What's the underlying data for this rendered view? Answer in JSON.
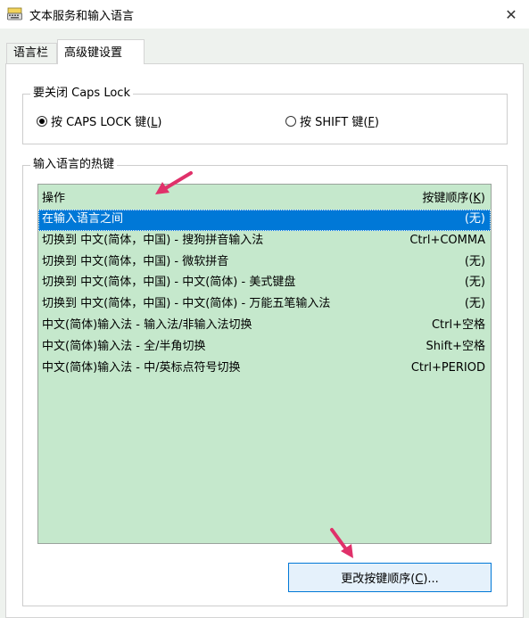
{
  "window": {
    "title": "文本服务和输入语言",
    "close_glyph": "✕",
    "icon": "keyboard-icon"
  },
  "tabs": [
    {
      "label": "语言栏",
      "selected": false
    },
    {
      "label": "高级键设置",
      "selected": true
    }
  ],
  "caps_lock_group": {
    "title": "要关闭 Caps Lock",
    "options": [
      {
        "label_prefix": "按 CAPS LOCK 键(",
        "accel": "L",
        "label_suffix": ")",
        "checked": true
      },
      {
        "label_prefix": "按 SHIFT 键(",
        "accel": "F",
        "label_suffix": ")",
        "checked": false
      }
    ]
  },
  "hotkeys_group": {
    "title": "输入语言的热键",
    "columns": {
      "action": "操作",
      "key_prefix": "按键顺序(",
      "key_accel": "K",
      "key_suffix": ")"
    },
    "rows": [
      {
        "action": "在输入语言之间",
        "key": "(无)",
        "selected": true
      },
      {
        "action": "切换到 中文(简体，中国) - 搜狗拼音输入法",
        "key": "Ctrl+COMMA",
        "selected": false
      },
      {
        "action": "切换到 中文(简体，中国) - 微软拼音",
        "key": "(无)",
        "selected": false
      },
      {
        "action": "切换到 中文(简体，中国) - 中文(简体) - 美式键盘",
        "key": "(无)",
        "selected": false
      },
      {
        "action": "切换到 中文(简体，中国) - 中文(简体) - 万能五笔输入法",
        "key": "(无)",
        "selected": false
      },
      {
        "action": "中文(简体)输入法 - 输入法/非输入法切换",
        "key": "Ctrl+空格",
        "selected": false
      },
      {
        "action": "中文(简体)输入法 - 全/半角切换",
        "key": "Shift+空格",
        "selected": false
      },
      {
        "action": "中文(简体)输入法 - 中/英标点符号切换",
        "key": "Ctrl+PERIOD",
        "selected": false
      }
    ],
    "change_button": {
      "label_prefix": "更改按键顺序(",
      "accel": "C",
      "label_suffix": ")..."
    }
  },
  "colors": {
    "list_background": "#c5e8cc",
    "selection": "#0078d7",
    "annotation_arrow": "#e0316a",
    "button_border": "#0078d7"
  }
}
